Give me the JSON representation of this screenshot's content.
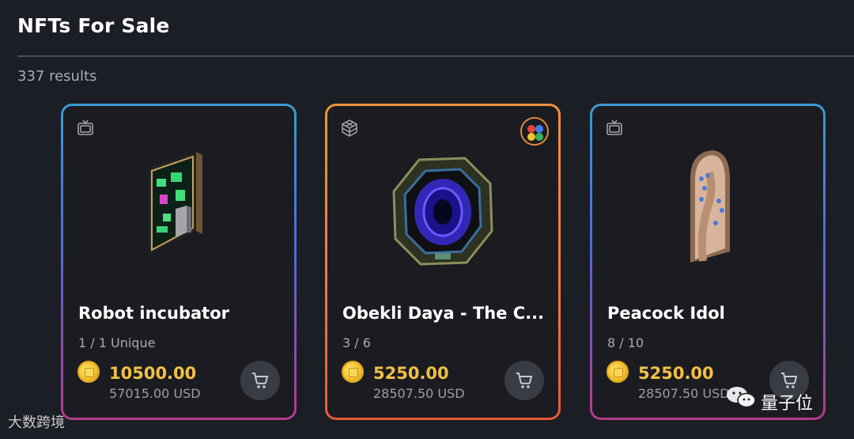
{
  "page": {
    "title": "NFTs For Sale",
    "results": "337 results"
  },
  "cards": [
    {
      "type_icon": "tv-icon",
      "name": "Robot incubator",
      "edition": "1 / 1 Unique",
      "price": "10500.00",
      "usd": "57015.00 USD"
    },
    {
      "type_icon": "cube-icon",
      "badge_icon": "colored-dots-badge-icon",
      "name": "Obekli Daya - The C...",
      "edition": "3 / 6",
      "price": "5250.00",
      "usd": "28507.50 USD"
    },
    {
      "type_icon": "tv-icon",
      "name": "Peacock Idol",
      "edition": "8 / 10",
      "price": "5250.00",
      "usd": "28507.50 USD"
    }
  ],
  "watermarks": {
    "left": "大数跨境",
    "right": "量子位"
  },
  "colors": {
    "background": "#1c1e25",
    "price": "#f2c144",
    "frame_blue": "#3b9ad0",
    "frame_orange": "#f0933d"
  }
}
